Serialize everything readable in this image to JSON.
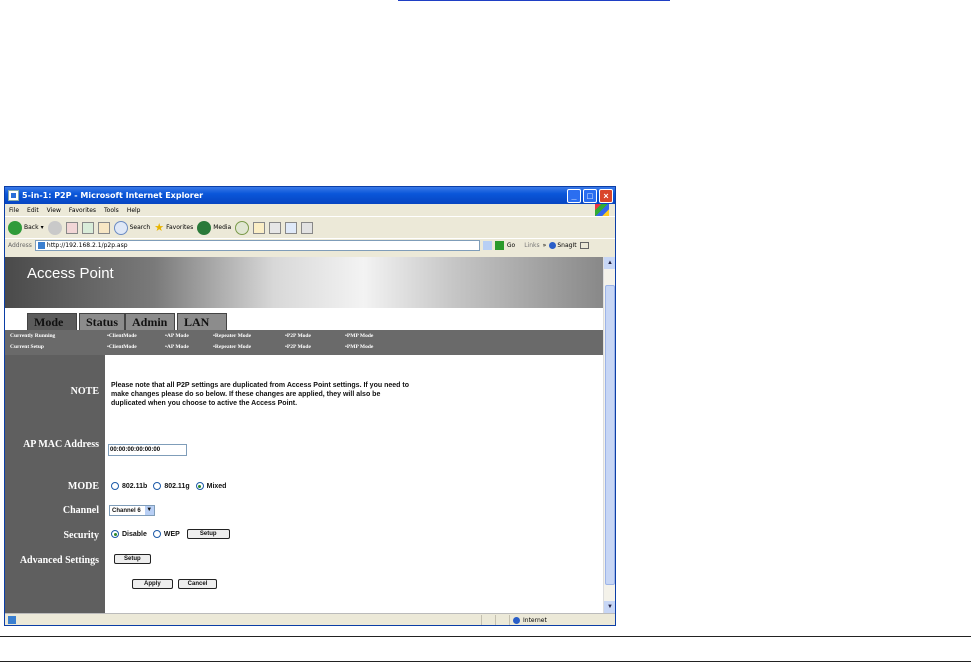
{
  "window": {
    "title": "5-in-1: P2P - Microsoft Internet Explorer",
    "min": "_",
    "max": "□",
    "close": "×"
  },
  "menubar": [
    "File",
    "Edit",
    "View",
    "Favorites",
    "Tools",
    "Help"
  ],
  "toolbar": {
    "back": "Back",
    "search": "Search",
    "favorites": "Favorites",
    "media": "Media"
  },
  "address": {
    "label": "Address",
    "url": "http://192.168.2.1/p2p.asp",
    "go": "Go",
    "links": "Links",
    "snagit": "SnagIt"
  },
  "header": {
    "title": "Access Point"
  },
  "tabs": [
    "Mode",
    "Status",
    "Admin",
    "LAN"
  ],
  "modes": {
    "running_label": "Currently Running",
    "setup_label": "Current Setup",
    "items": [
      "•ClientMode",
      "•AP Mode",
      "•Repeater Mode",
      "•P2P Mode",
      "•PMP Mode"
    ]
  },
  "labels": {
    "note": "NOTE",
    "ap_mac": "AP MAC Address",
    "mode": "MODE",
    "channel": "Channel",
    "security": "Security",
    "advanced": "Advanced Settings"
  },
  "note_text": "Please note that all P2P settings are duplicated from Access Point settings. If you need to make changes please do so below. If these changes are applied, they will also be duplicated when you choose to active the Access Point.",
  "form": {
    "mac_value": "00:00:00:00:00:00",
    "mode_options": [
      "802.11b",
      "802.11g",
      "Mixed"
    ],
    "channel_value": "Channel 6",
    "security_options": [
      "Disable",
      "WEP"
    ],
    "setup_label": "Setup",
    "apply_label": "Apply",
    "cancel_label": "Cancel"
  },
  "statusbar": {
    "zone": "Internet"
  }
}
